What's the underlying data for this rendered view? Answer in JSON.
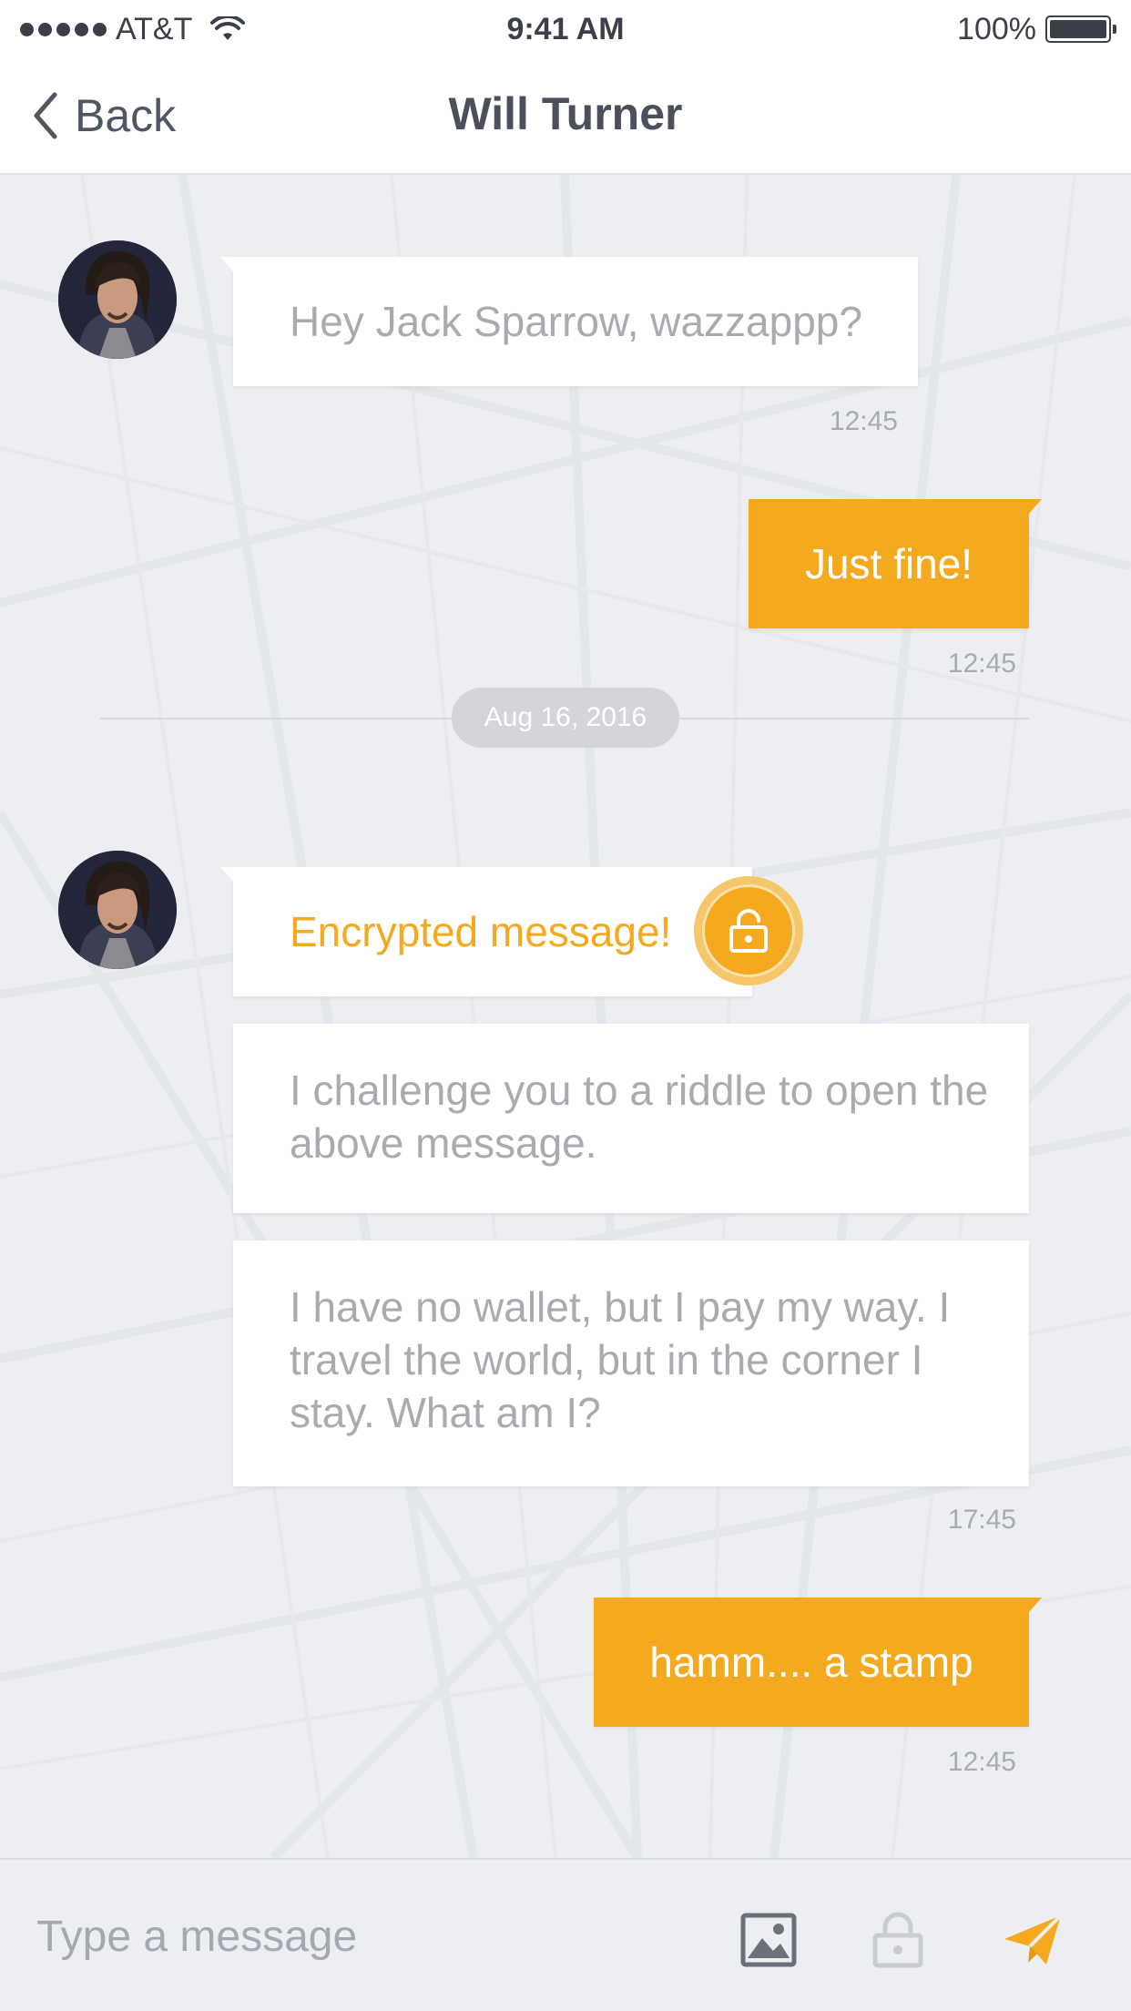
{
  "status_bar": {
    "carrier": "AT&T",
    "time": "9:41 AM",
    "battery": "100%",
    "signal_bars": 5
  },
  "nav": {
    "back_label": "Back",
    "title": "Will Turner"
  },
  "colors": {
    "accent": "#f4a91f",
    "incoming_text": "#a9abb0",
    "chat_background": "#eceef2"
  },
  "messages": [
    {
      "direction": "incoming",
      "text": "Hey Jack Sparrow, wazzappp?",
      "time": "12:45"
    },
    {
      "direction": "outgoing",
      "text": "Just fine!",
      "time": "12:45"
    },
    {
      "direction": "incoming",
      "text": "Encrypted message!",
      "encrypted": true
    },
    {
      "direction": "incoming",
      "text": "I challenge you to a riddle to open the above message."
    },
    {
      "direction": "incoming",
      "text": "I have no wallet, but I pay my way. I travel the world, but in the corner I stay. What am I?",
      "time": "17:45"
    },
    {
      "direction": "outgoing",
      "text": "hamm.... a stamp",
      "time": "12:45"
    }
  ],
  "date_separator": "Aug 16, 2016",
  "composer": {
    "placeholder": "Type a message",
    "icons": [
      "image-icon",
      "lock-icon",
      "send-icon"
    ]
  }
}
